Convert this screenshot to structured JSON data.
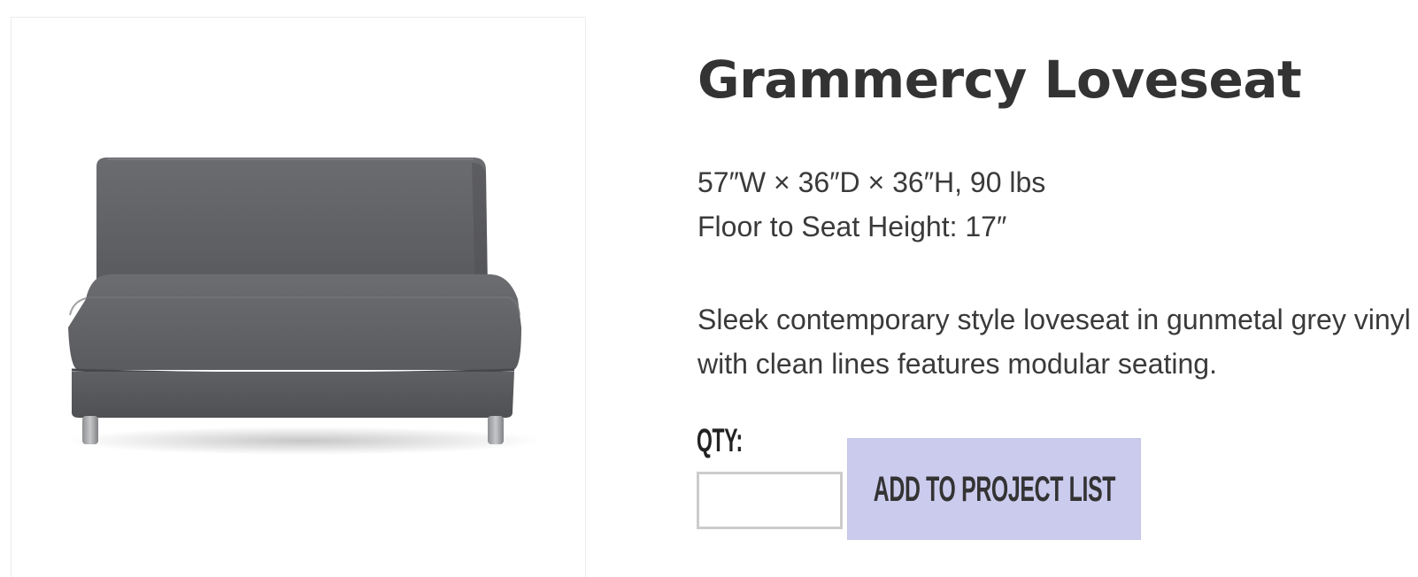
{
  "product": {
    "title": "Grammercy Loveseat",
    "dimensions": "57″W × 36″D × 36″H, 90 lbs",
    "seat_height": "Floor to Seat Height: 17″",
    "description": "Sleek contemporary style loveseat in gunmetal grey vinyl with clean lines features modular seating.",
    "image_icon": "loveseat-photo",
    "upholstery_color": "#5e5f62"
  },
  "order": {
    "qty_label": "QTY:",
    "qty_value": "",
    "qty_placeholder": "",
    "add_button_label": "ADD TO PROJECT LIST",
    "button_color": "#cbcbee"
  }
}
